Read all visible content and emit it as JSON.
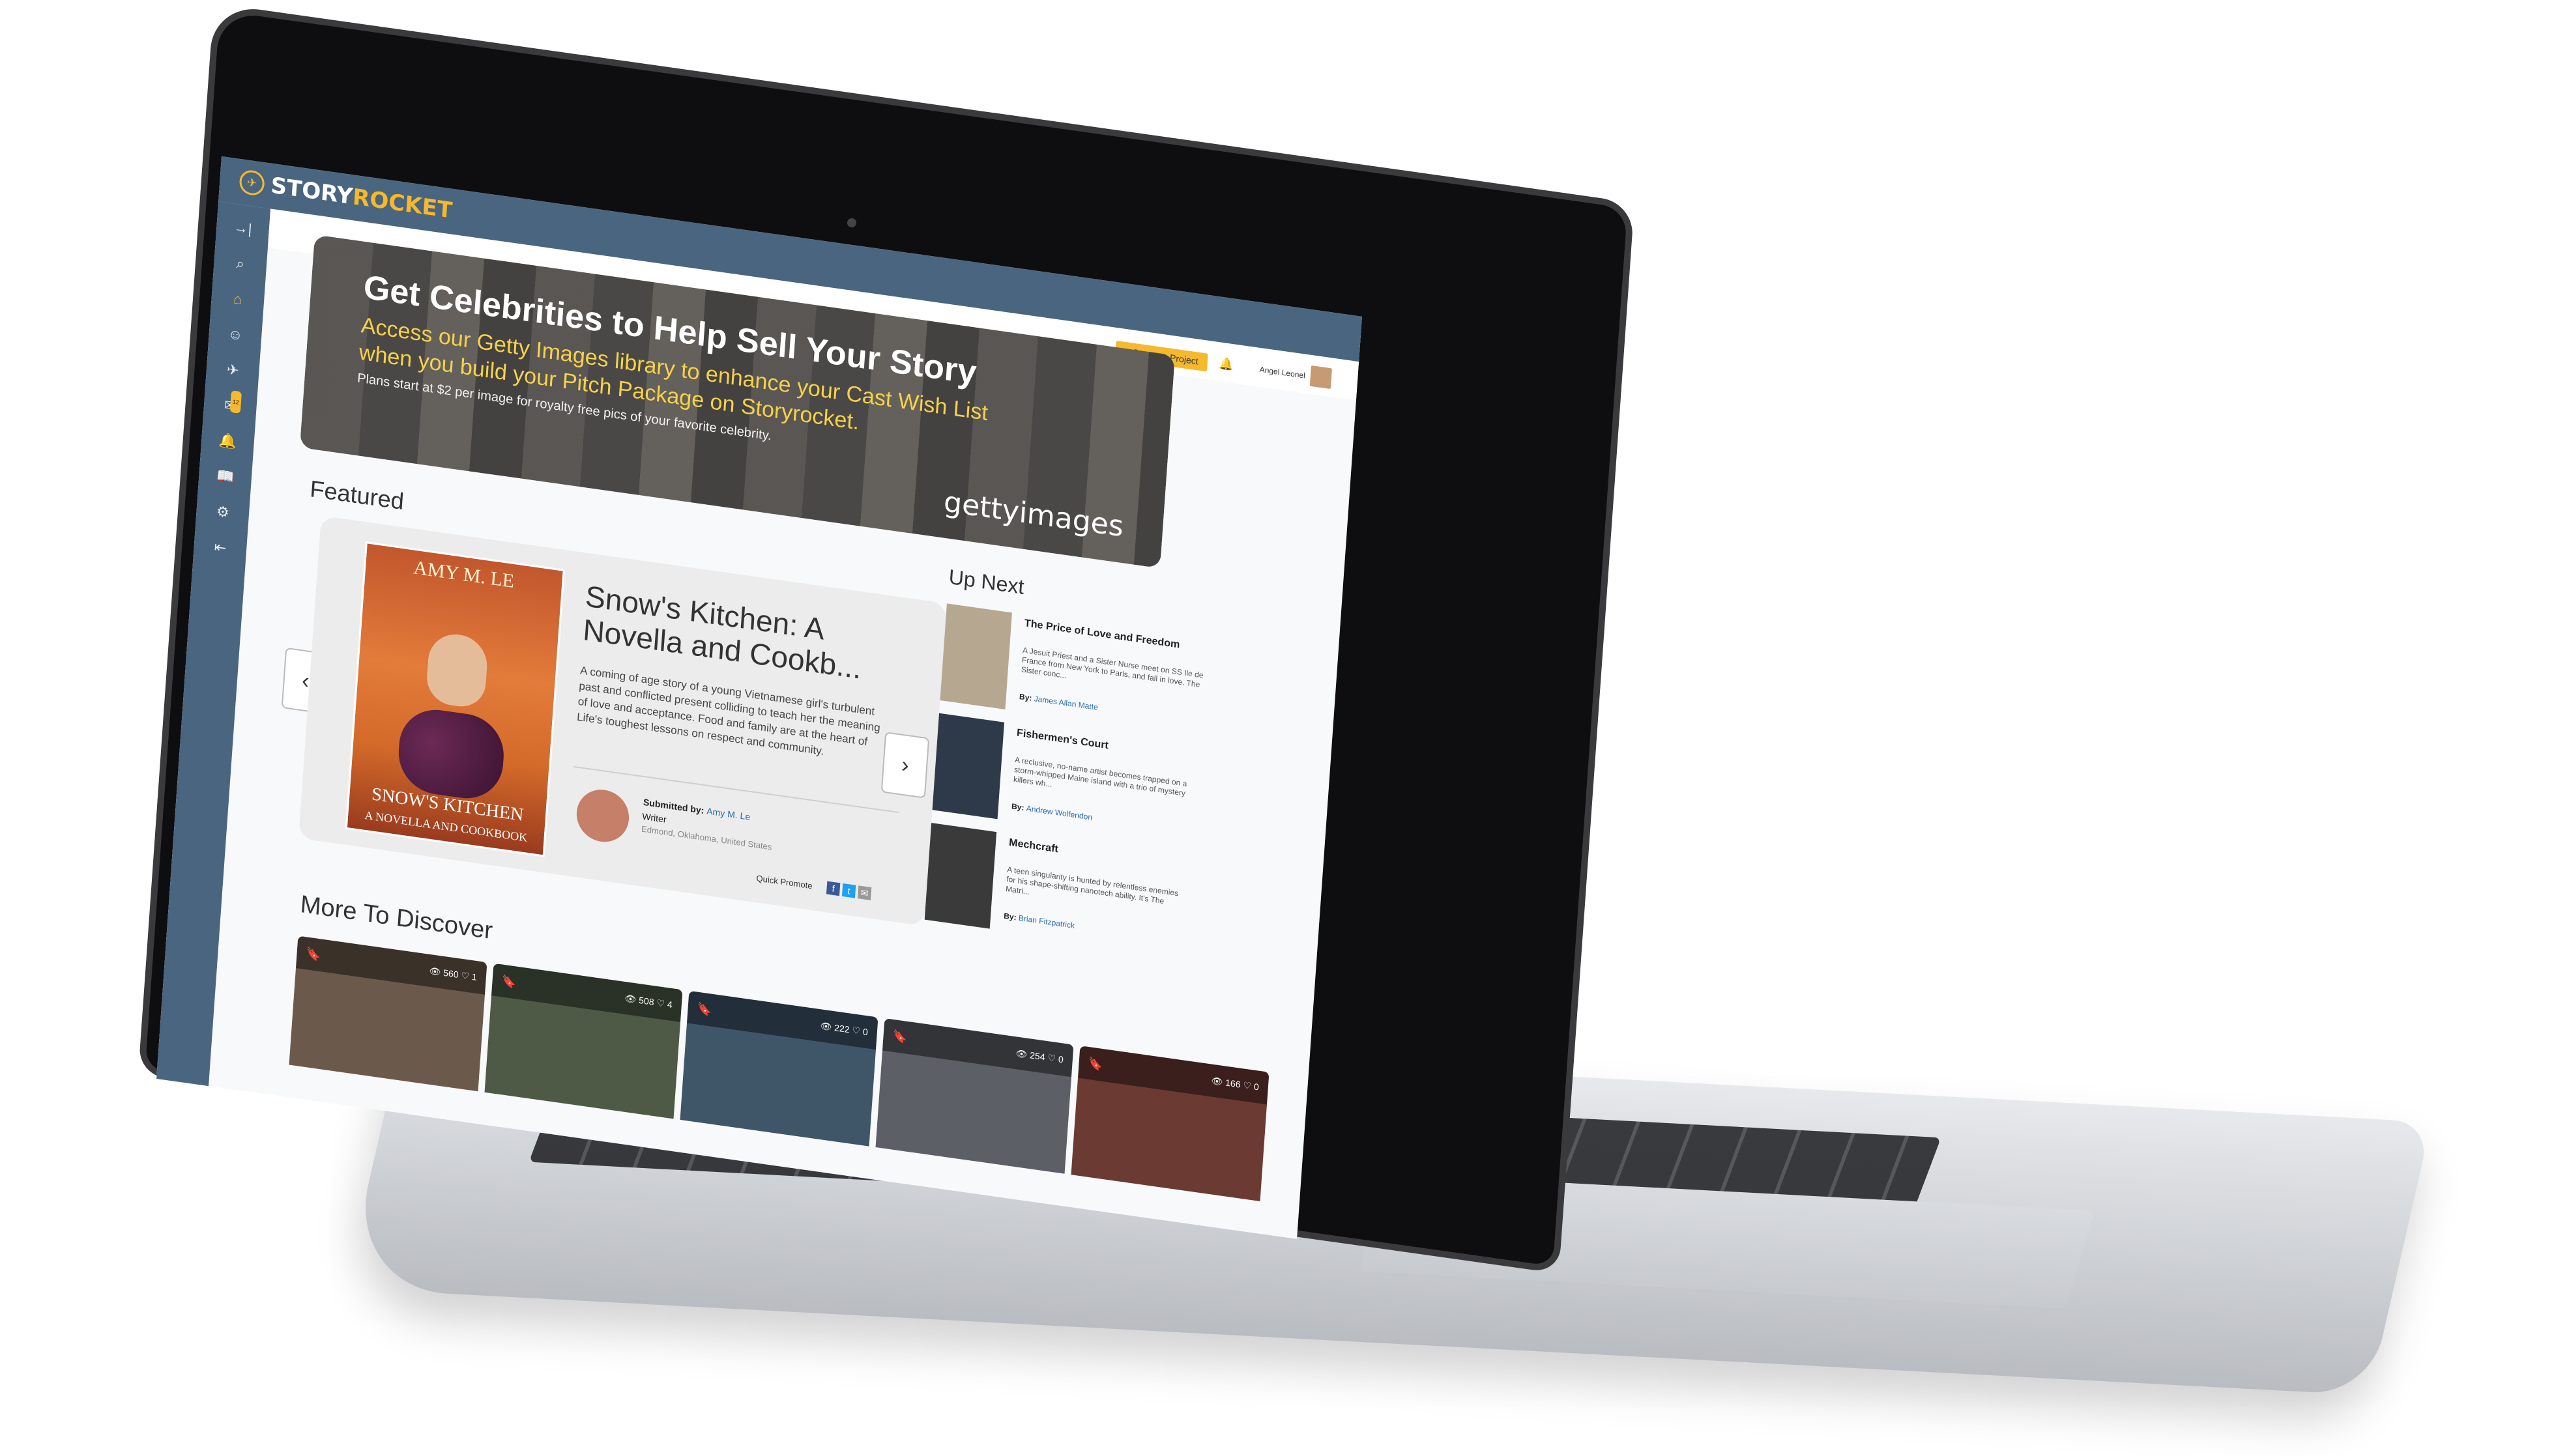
{
  "app": {
    "logo_story": "STORY",
    "logo_rocket": "ROCKET"
  },
  "header": {
    "create_label": "+ Create a Project",
    "username": "Angel Leonel"
  },
  "sidebar": {
    "items": [
      {
        "name": "collapse",
        "icon": "→|"
      },
      {
        "name": "search",
        "icon": "⌕"
      },
      {
        "name": "home",
        "icon": "⌂"
      },
      {
        "name": "profile",
        "icon": "☺"
      },
      {
        "name": "rocket",
        "icon": "✈"
      },
      {
        "name": "messages",
        "icon": "✉",
        "badge": "12"
      },
      {
        "name": "notifications",
        "icon": "🔔"
      },
      {
        "name": "library",
        "icon": "📖"
      },
      {
        "name": "settings",
        "icon": "⚙"
      },
      {
        "name": "logout",
        "icon": "⇤"
      }
    ]
  },
  "banner": {
    "title": "Get Celebrities to Help Sell Your Story",
    "line1": "Access our Getty Images library to enhance your Cast Wish List",
    "line2": "when you build your Pitch Package on Storyrocket.",
    "line3": "Plans start at $2 per image for royalty free pics of your favorite celebrity.",
    "brand": "gettyimages"
  },
  "featured": {
    "heading": "Featured",
    "cover_author": "AMY M. LE",
    "cover_title": "SNOW'S KITCHEN",
    "cover_subtitle": "A NOVELLA AND COOKBOOK",
    "title": "Snow's Kitchen: A Novella and Cookb...",
    "description": "A coming of age story of a young Vietnamese girl's turbulent past and conflicted present colliding to teach her the meaning of love and acceptance. Food and family are at the heart of Life's toughest lessons on respect and community.",
    "submitted_by_label": "Submitted by: ",
    "submitter": "Amy M. Le",
    "role": "Writer",
    "location": "Edmond, Oklahoma, United States",
    "quick_promote": "Quick Promote"
  },
  "up_next": {
    "heading": "Up Next",
    "items": [
      {
        "title": "The Price of Love and Freedom",
        "desc": "A Jesuit Priest and a Sister Nurse meet on SS Ile de France from New York to Paris, and fall in love. The Sister conc...",
        "by_label": "By: ",
        "author": "James Allan Matte",
        "thumb": "#b6a890"
      },
      {
        "title": "Fishermen's Court",
        "desc": "A reclusive, no-name artist becomes trapped on a storm-whipped Maine island with a trio of mystery killers wh...",
        "by_label": "By: ",
        "author": "Andrew Wolfendon",
        "thumb": "#2e3a4a"
      },
      {
        "title": "Mechcraft",
        "desc": "A teen singularity is hunted by relentless enemies for his shape-shifting nanotech ability. It's The Matri...",
        "by_label": "By: ",
        "author": "Brian Fitzpatrick",
        "thumb": "#3a3a3a"
      }
    ]
  },
  "more": {
    "heading": "More To Discover",
    "items": [
      {
        "views": "560",
        "likes": "1",
        "bg": "#6b5a4c"
      },
      {
        "views": "508",
        "likes": "4",
        "bg": "#4e5a45"
      },
      {
        "views": "222",
        "likes": "0",
        "bg": "#3f5568"
      },
      {
        "views": "254",
        "likes": "0",
        "bg": "#5c5f66"
      },
      {
        "views": "166",
        "likes": "0",
        "bg": "#6a3a33"
      }
    ]
  }
}
